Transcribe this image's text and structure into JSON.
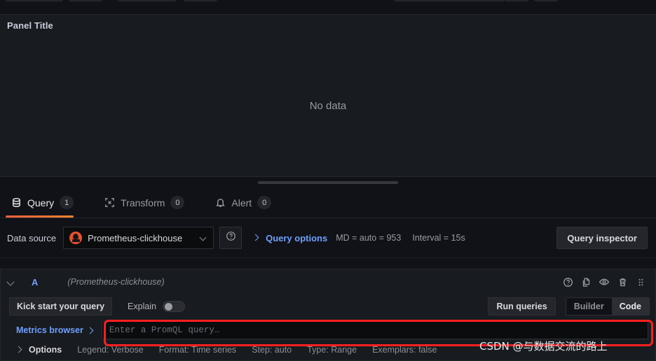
{
  "panel": {
    "title": "Panel Title",
    "no_data": "No data"
  },
  "tabs": [
    {
      "label": "Query",
      "count": "1",
      "icon": "database-icon",
      "active": true
    },
    {
      "label": "Transform",
      "count": "0",
      "icon": "transform-icon",
      "active": false
    },
    {
      "label": "Alert",
      "count": "0",
      "icon": "bell-icon",
      "active": false
    }
  ],
  "datasource_row": {
    "label": "Data source",
    "selected": "Prometheus-clickhouse",
    "logo": "prometheus-logo",
    "help_icon": "question-circle-icon",
    "query_options_label": "Query options",
    "max_data_points": "MD = auto = 953",
    "interval": "Interval = 15s",
    "query_inspector_label": "Query inspector"
  },
  "query_row": {
    "ref_id": "A",
    "datasource_note": "(Prometheus-clickhouse)",
    "actions": [
      {
        "icon": "question-circle-icon",
        "name": "query-help-icon"
      },
      {
        "icon": "copy-icon",
        "name": "duplicate-query-icon"
      },
      {
        "icon": "eye-icon",
        "name": "toggle-query-visibility-icon"
      },
      {
        "icon": "trash-icon",
        "name": "remove-query-icon"
      },
      {
        "icon": "drag-handle-icon",
        "name": "drag-query-icon"
      }
    ],
    "kick_start_label": "Kick start your query",
    "explain_label": "Explain",
    "explain_on": false,
    "run_queries_label": "Run queries",
    "editor_modes": [
      {
        "label": "Builder",
        "selected": false
      },
      {
        "label": "Code",
        "selected": true
      }
    ],
    "metrics_browser_label": "Metrics browser",
    "promql_placeholder": "Enter a PromQL query…",
    "promql_value": ""
  },
  "query_options_footer": {
    "title": "Options",
    "items": [
      "Legend: Verbose",
      "Format: Time series",
      "Step: auto",
      "Type: Range",
      "Exemplars: false"
    ]
  },
  "annotation": {
    "highlight_color": "#ff2020",
    "watermark": "CSDN @与数据交流的路上"
  },
  "colors": {
    "accent_blue": "#6e9fff",
    "tab_underline": "#f55f3e",
    "prometheus_orange": "#e6522c",
    "panel_bg": "#181b1f",
    "app_bg": "#111217"
  }
}
